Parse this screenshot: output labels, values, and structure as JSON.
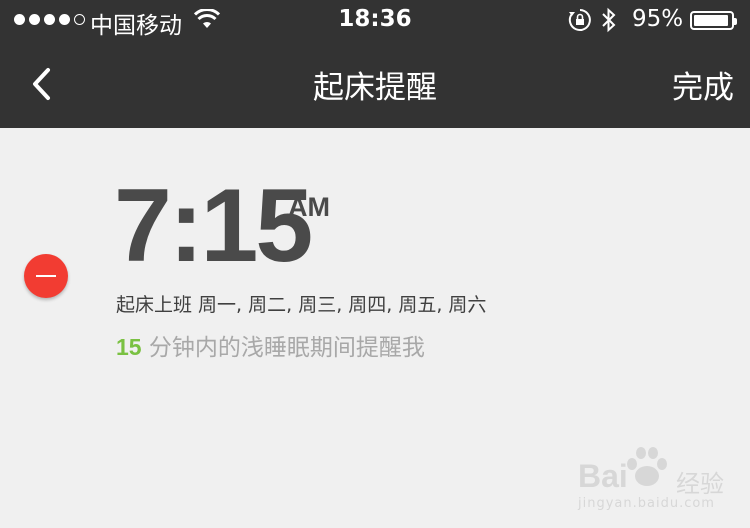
{
  "status_bar": {
    "signal_dots_filled": 4,
    "signal_dots_total": 5,
    "carrier": "中国移动",
    "time": "18:36",
    "battery_percent": "95%",
    "battery_level": 0.95
  },
  "nav": {
    "title": "起床提醒",
    "done_label": "完成",
    "back_icon": "chevron-left-icon"
  },
  "alarm": {
    "time": "7:15",
    "period": "AM",
    "repeat": "起床上班 周一, 周二, 周三, 周四, 周五, 周六",
    "window_minutes": "15",
    "window_text": " 分钟内的浅睡眠期间提醒我"
  },
  "watermark": {
    "brand": "Bai",
    "brand_cn": "经验",
    "url": "jingyan.baidu.com"
  },
  "colors": {
    "nav_bg": "#333333",
    "page_bg": "#f0f0f0",
    "delete": "#f23c32",
    "accent_green": "#7ac142",
    "time_text": "#4a4a4a"
  }
}
